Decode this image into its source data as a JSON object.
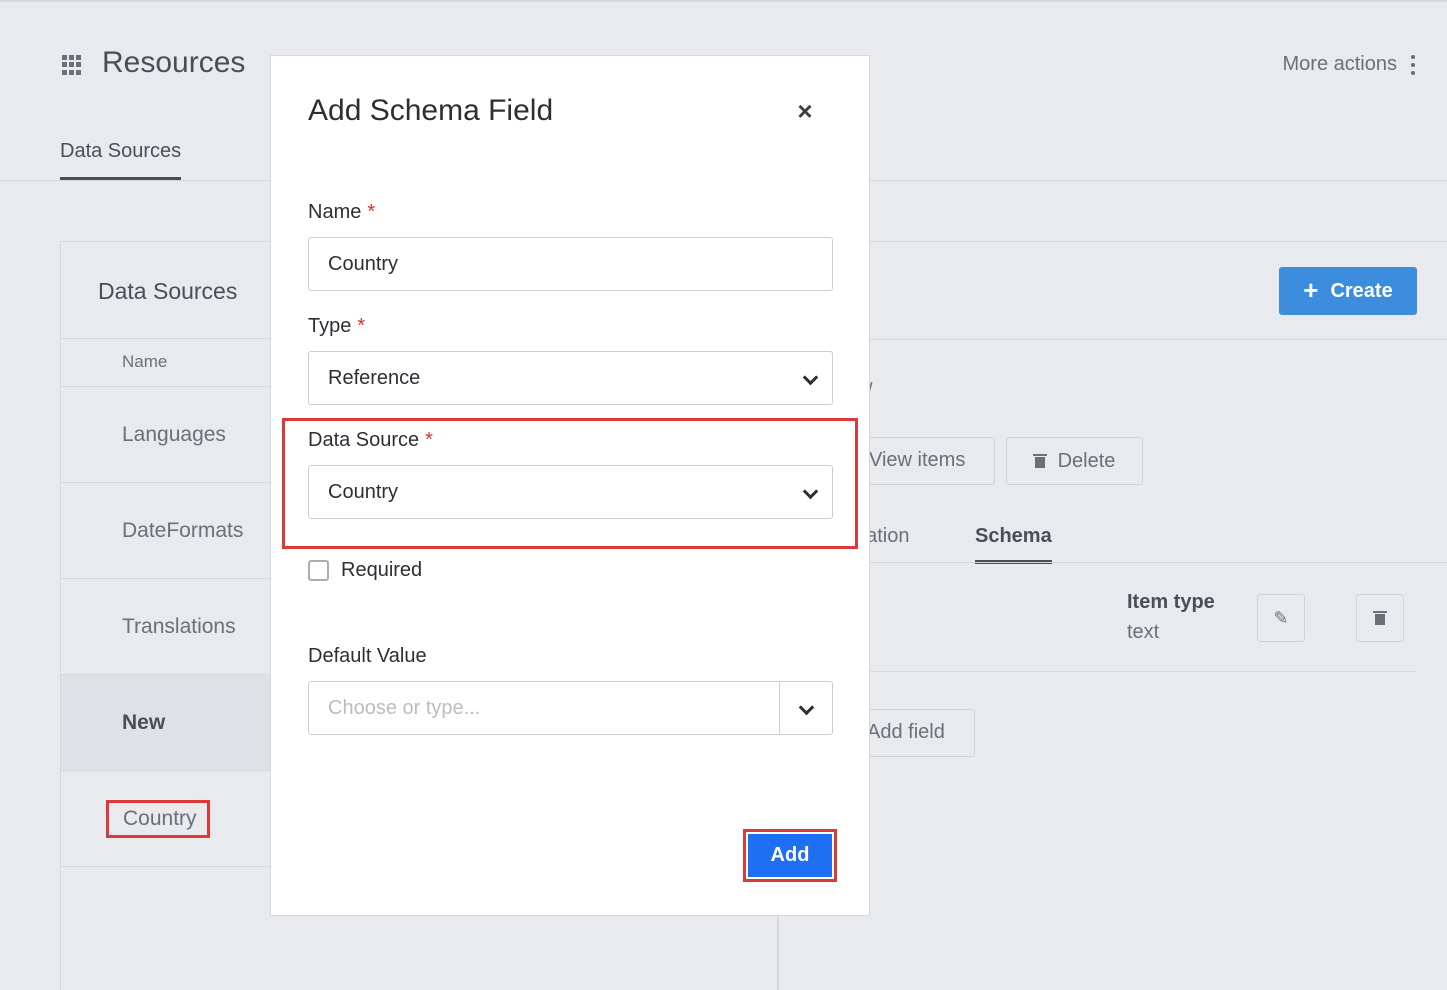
{
  "app": {
    "title": "Resources",
    "more_actions": "More actions"
  },
  "top_tabs": [
    {
      "label": "Data Sources"
    }
  ],
  "left_panel": {
    "title": "Data Sources",
    "column_header": "Name",
    "rows": [
      {
        "label": "Languages"
      },
      {
        "label": "DateFormats"
      },
      {
        "label": "Translations"
      },
      {
        "label": "New"
      },
      {
        "label": "Country"
      }
    ]
  },
  "right_panel": {
    "create_label": "Create",
    "stub_text": "/",
    "view_items_label": "View items",
    "delete_label": "Delete",
    "tabs": {
      "info": "nation",
      "schema": "Schema"
    },
    "item_type_label": "Item type",
    "item_type_value": "text",
    "add_field_label": "Add field"
  },
  "modal": {
    "title": "Add Schema Field",
    "close_symbol": "×",
    "name_label": "Name",
    "name_value": "Country",
    "type_label": "Type",
    "type_value": "Reference",
    "data_source_label": "Data Source",
    "data_source_value": "Country",
    "required_label": "Required",
    "required_checked": false,
    "default_value_label": "Default Value",
    "default_value_placeholder": "Choose or type...",
    "required_marker": "*",
    "add_label": "Add"
  },
  "colors": {
    "highlight": "#dc3a3a",
    "primary": "#1e6ff1",
    "create": "#3d8ddf",
    "required": "#d9342b"
  }
}
